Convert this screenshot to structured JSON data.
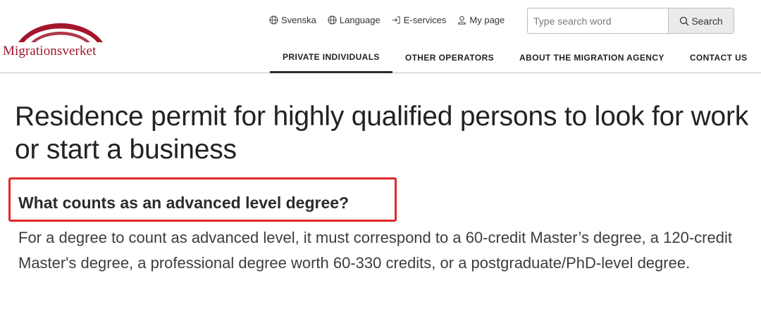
{
  "header": {
    "logo_text": "Migrationsverket",
    "brand_color": "#a3152b",
    "utility_links": [
      {
        "label": "Svenska",
        "icon": "globe-icon"
      },
      {
        "label": "Language",
        "icon": "globe-icon"
      },
      {
        "label": "E-services",
        "icon": "login-arrow-icon"
      },
      {
        "label": "My page",
        "icon": "user-icon"
      }
    ],
    "search": {
      "placeholder": "Type search word",
      "value": "",
      "button_label": "Search"
    },
    "nav": [
      {
        "label": "PRIVATE INDIVIDUALS",
        "active": true
      },
      {
        "label": "OTHER OPERATORS",
        "active": false
      },
      {
        "label": "ABOUT THE MIGRATION AGENCY",
        "active": false
      },
      {
        "label": "CONTACT US",
        "active": false
      }
    ]
  },
  "main": {
    "title": "Residence permit for highly qualified persons to look for work or start a business",
    "section_heading": "What counts as an advanced level degree?",
    "body": "For a degree to count as advanced level, it must correspond to a 60-credit Master’s degree, a 120-credit Master's degree, a professional degree worth 60-330 credits, or a postgraduate/PhD-level degree.",
    "highlight_color": "#e02828"
  }
}
